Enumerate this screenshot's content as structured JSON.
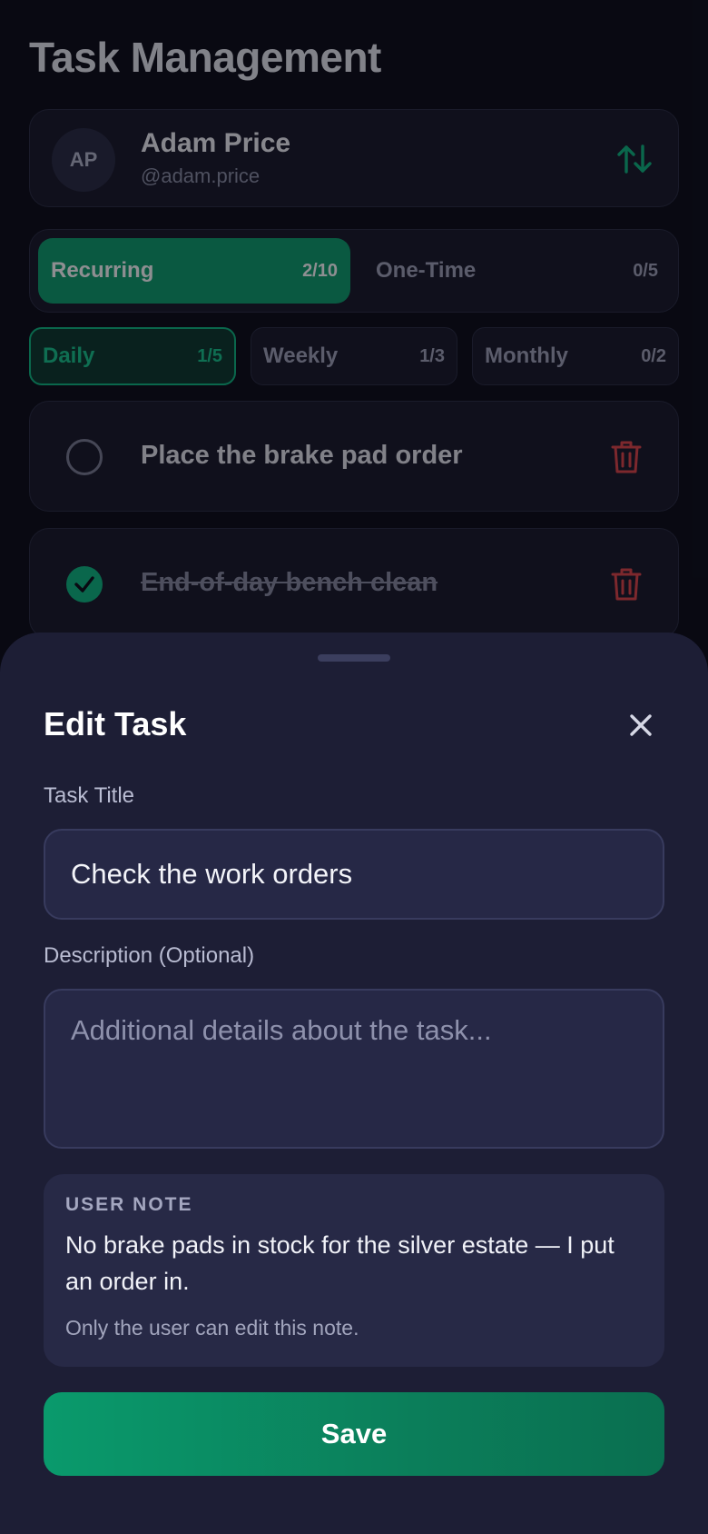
{
  "page": {
    "title": "Task Management"
  },
  "user": {
    "initials": "AP",
    "name": "Adam Price",
    "handle": "@adam.price",
    "sort_icon": "sort-arrows-icon"
  },
  "segments": [
    {
      "label": "Recurring",
      "count": "2/10",
      "active": true
    },
    {
      "label": "One-Time",
      "count": "0/5",
      "active": false
    }
  ],
  "periods": [
    {
      "label": "Daily",
      "count": "1/5",
      "active": true
    },
    {
      "label": "Weekly",
      "count": "1/3",
      "active": false
    },
    {
      "label": "Monthly",
      "count": "0/2",
      "active": false
    }
  ],
  "tasks": [
    {
      "title": "Place the brake pad order",
      "done": false
    },
    {
      "title": "End-of-day bench clean",
      "done": true
    }
  ],
  "sheet": {
    "title": "Edit Task",
    "task_title_label": "Task Title",
    "task_title_value": "Check the work orders",
    "description_label": "Description (Optional)",
    "description_placeholder": "Additional details about the task...",
    "note": {
      "label": "USER NOTE",
      "body": "No brake pads in stock for the silver estate — I put an order in.",
      "hint": "Only the user can edit this note."
    },
    "save_label": "Save"
  },
  "colors": {
    "accent": "#10b981",
    "danger": "#e0454a",
    "sheet_bg": "#1d1e35",
    "page_bg": "#0d0e18"
  }
}
